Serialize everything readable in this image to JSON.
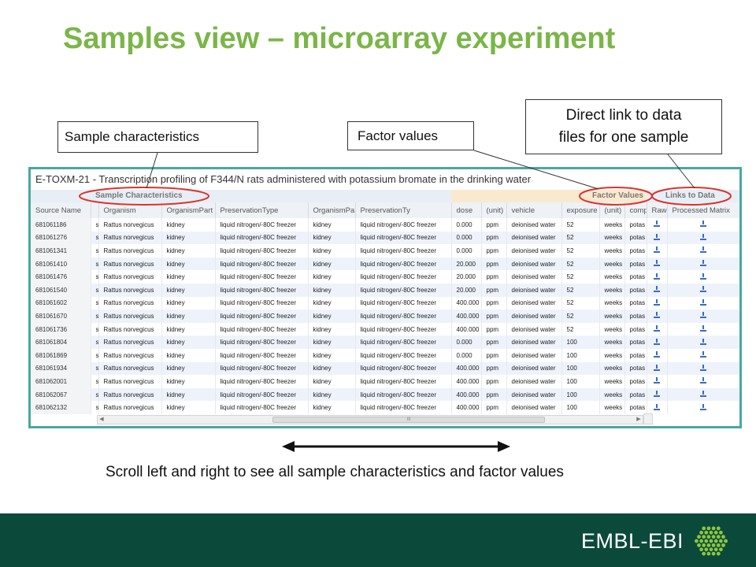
{
  "slide": {
    "title": "Samples view – microarray experiment",
    "scroll_caption": "Scroll left and right to see all sample characteristics and factor values",
    "footer_brand": "EMBL-EBI"
  },
  "callouts": {
    "sample_characteristics": "Sample characteristics",
    "factor_values": "Factor values",
    "direct_link_line1": "Direct link to data",
    "direct_link_line2": "files for one sample"
  },
  "experiment": {
    "title": "E-TOXM-21 - Transcription profiling of F344/N rats administered with potassium bromate in the drinking water"
  },
  "groups": {
    "sample_characteristics": "Sample Characteristics",
    "factor_values": "Factor Values",
    "links_to_data": "Links to Data"
  },
  "columns": [
    "Source Name",
    "",
    "Organism",
    "OrganismPart",
    "PreservationType",
    "OrganismPa",
    "PreservationTy",
    "dose",
    "(unit)",
    "vehicle",
    "exposure",
    "(unit)",
    "comp",
    "Raw",
    "Processed Matrix"
  ],
  "rows": [
    {
      "source": "681061186",
      "s": "s",
      "organism": "Rattus norvegicus",
      "part": "kidney",
      "preservation": "liquid nitrogen/-80C freezer",
      "part2": "kidney",
      "preservation2": "liquid nitrogen/-80C freezer",
      "dose": "0.000",
      "dose_unit": "ppm",
      "vehicle": "deionised water",
      "exposure": "52",
      "exposure_unit": "weeks",
      "comp": "potas"
    },
    {
      "source": "681061276",
      "s": "s",
      "organism": "Rattus norvegicus",
      "part": "kidney",
      "preservation": "liquid nitrogen/-80C freezer",
      "part2": "kidney",
      "preservation2": "liquid nitrogen/-80C freezer",
      "dose": "0.000",
      "dose_unit": "ppm",
      "vehicle": "deionised water",
      "exposure": "52",
      "exposure_unit": "weeks",
      "comp": "potas"
    },
    {
      "source": "681061341",
      "s": "s",
      "organism": "Rattus norvegicus",
      "part": "kidney",
      "preservation": "liquid nitrogen/-80C freezer",
      "part2": "kidney",
      "preservation2": "liquid nitrogen/-80C freezer",
      "dose": "0.000",
      "dose_unit": "ppm",
      "vehicle": "deionised water",
      "exposure": "52",
      "exposure_unit": "weeks",
      "comp": "potas"
    },
    {
      "source": "681061410",
      "s": "s",
      "organism": "Rattus norvegicus",
      "part": "kidney",
      "preservation": "liquid nitrogen/-80C freezer",
      "part2": "kidney",
      "preservation2": "liquid nitrogen/-80C freezer",
      "dose": "20.000",
      "dose_unit": "ppm",
      "vehicle": "deionised water",
      "exposure": "52",
      "exposure_unit": "weeks",
      "comp": "potas"
    },
    {
      "source": "681061476",
      "s": "s",
      "organism": "Rattus norvegicus",
      "part": "kidney",
      "preservation": "liquid nitrogen/-80C freezer",
      "part2": "kidney",
      "preservation2": "liquid nitrogen/-80C freezer",
      "dose": "20.000",
      "dose_unit": "ppm",
      "vehicle": "deionised water",
      "exposure": "52",
      "exposure_unit": "weeks",
      "comp": "potas"
    },
    {
      "source": "681061540",
      "s": "s",
      "organism": "Rattus norvegicus",
      "part": "kidney",
      "preservation": "liquid nitrogen/-80C freezer",
      "part2": "kidney",
      "preservation2": "liquid nitrogen/-80C freezer",
      "dose": "20.000",
      "dose_unit": "ppm",
      "vehicle": "deionised water",
      "exposure": "52",
      "exposure_unit": "weeks",
      "comp": "potas"
    },
    {
      "source": "681061602",
      "s": "s",
      "organism": "Rattus norvegicus",
      "part": "kidney",
      "preservation": "liquid nitrogen/-80C freezer",
      "part2": "kidney",
      "preservation2": "liquid nitrogen/-80C freezer",
      "dose": "400.000",
      "dose_unit": "ppm",
      "vehicle": "deionised water",
      "exposure": "52",
      "exposure_unit": "weeks",
      "comp": "potas"
    },
    {
      "source": "681061670",
      "s": "s",
      "organism": "Rattus norvegicus",
      "part": "kidney",
      "preservation": "liquid nitrogen/-80C freezer",
      "part2": "kidney",
      "preservation2": "liquid nitrogen/-80C freezer",
      "dose": "400.000",
      "dose_unit": "ppm",
      "vehicle": "deionised water",
      "exposure": "52",
      "exposure_unit": "weeks",
      "comp": "potas"
    },
    {
      "source": "681061736",
      "s": "s",
      "organism": "Rattus norvegicus",
      "part": "kidney",
      "preservation": "liquid nitrogen/-80C freezer",
      "part2": "kidney",
      "preservation2": "liquid nitrogen/-80C freezer",
      "dose": "400.000",
      "dose_unit": "ppm",
      "vehicle": "deionised water",
      "exposure": "52",
      "exposure_unit": "weeks",
      "comp": "potas"
    },
    {
      "source": "681061804",
      "s": "s",
      "organism": "Rattus norvegicus",
      "part": "kidney",
      "preservation": "liquid nitrogen/-80C freezer",
      "part2": "kidney",
      "preservation2": "liquid nitrogen/-80C freezer",
      "dose": "0.000",
      "dose_unit": "ppm",
      "vehicle": "deionised water",
      "exposure": "100",
      "exposure_unit": "weeks",
      "comp": "potas"
    },
    {
      "source": "681061869",
      "s": "s",
      "organism": "Rattus norvegicus",
      "part": "kidney",
      "preservation": "liquid nitrogen/-80C freezer",
      "part2": "kidney",
      "preservation2": "liquid nitrogen/-80C freezer",
      "dose": "0.000",
      "dose_unit": "ppm",
      "vehicle": "deionised water",
      "exposure": "100",
      "exposure_unit": "weeks",
      "comp": "potas"
    },
    {
      "source": "681061934",
      "s": "s",
      "organism": "Rattus norvegicus",
      "part": "kidney",
      "preservation": "liquid nitrogen/-80C freezer",
      "part2": "kidney",
      "preservation2": "liquid nitrogen/-80C freezer",
      "dose": "400.000",
      "dose_unit": "ppm",
      "vehicle": "deionised water",
      "exposure": "100",
      "exposure_unit": "weeks",
      "comp": "potas"
    },
    {
      "source": "681062001",
      "s": "s",
      "organism": "Rattus norvegicus",
      "part": "kidney",
      "preservation": "liquid nitrogen/-80C freezer",
      "part2": "kidney",
      "preservation2": "liquid nitrogen/-80C freezer",
      "dose": "400.000",
      "dose_unit": "ppm",
      "vehicle": "deionised water",
      "exposure": "100",
      "exposure_unit": "weeks",
      "comp": "potas"
    },
    {
      "source": "681062067",
      "s": "s",
      "organism": "Rattus norvegicus",
      "part": "kidney",
      "preservation": "liquid nitrogen/-80C freezer",
      "part2": "kidney",
      "preservation2": "liquid nitrogen/-80C freezer",
      "dose": "400.000",
      "dose_unit": "ppm",
      "vehicle": "deionised water",
      "exposure": "100",
      "exposure_unit": "weeks",
      "comp": "potas"
    },
    {
      "source": "681062132",
      "s": "s",
      "organism": "Rattus norvegicus",
      "part": "kidney",
      "preservation": "liquid nitrogen/-80C freezer",
      "part2": "kidney",
      "preservation2": "liquid nitrogen/-80C freezer",
      "dose": "400.000",
      "dose_unit": "ppm",
      "vehicle": "deionised water",
      "exposure": "100",
      "exposure_unit": "weeks",
      "comp": "potas"
    }
  ],
  "scrollbar": {
    "thumb_label": "III"
  },
  "icons": {
    "raw_download": "download-icon",
    "processed_download": "download-icon",
    "footer_logo": "embl-ebi-hexagon-logo"
  },
  "colors": {
    "title_green": "#7ab648",
    "frame_teal": "#4aa8a0",
    "highlight_red": "#d9342b",
    "footer_green": "#0b4a3a",
    "logo_green": "#8cc63f"
  }
}
